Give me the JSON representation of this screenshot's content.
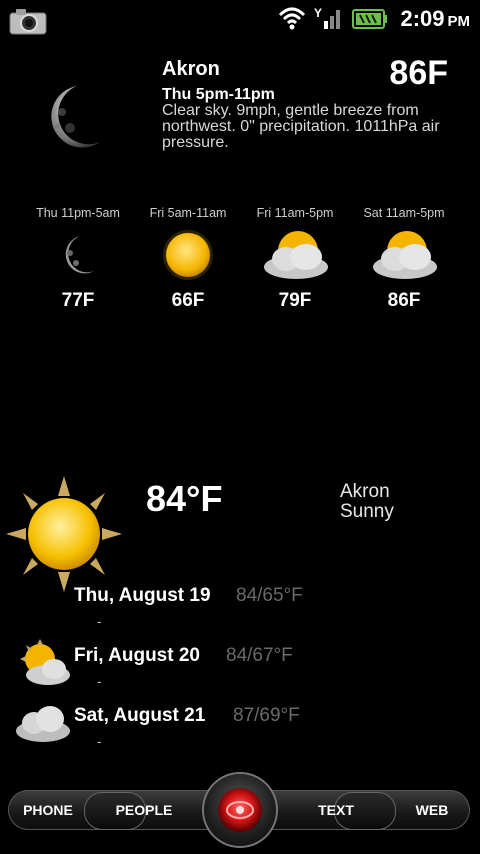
{
  "status": {
    "time": "2:09",
    "ampm": "PM"
  },
  "header": {
    "city": "Akron",
    "temp": "86F",
    "period": "Thu 5pm-11pm",
    "description": "Clear sky. 9mph, gentle breeze from northwest. 0\" precipitation. 1011hPa air pressure."
  },
  "forecast": [
    {
      "label": "Thu 11pm-5am",
      "temp": "77F",
      "icon": "moon-icon"
    },
    {
      "label": "Fri 5am-11am",
      "temp": "66F",
      "icon": "sun-icon"
    },
    {
      "label": "Fri 11am-5pm",
      "temp": "79F",
      "icon": "partly-cloudy-icon"
    },
    {
      "label": "Sat 11am-5pm",
      "temp": "86F",
      "icon": "partly-cloudy-icon"
    }
  ],
  "current": {
    "temp": "84°F",
    "city": "Akron",
    "condition": "Sunny"
  },
  "days": [
    {
      "name": "Thu, August 19",
      "range": "84/65°F",
      "extra": "-",
      "icon": "none"
    },
    {
      "name": "Fri, August 20",
      "range": "84/67°F",
      "extra": "-",
      "icon": "partly-cloudy-icon"
    },
    {
      "name": "Sat, August 21",
      "range": "87/69°F",
      "extra": "-",
      "icon": "cloud-icon"
    }
  ],
  "dock": {
    "phone": "PHONE",
    "people": "PEOPLE",
    "text": "TEXT",
    "web": "WEB"
  }
}
